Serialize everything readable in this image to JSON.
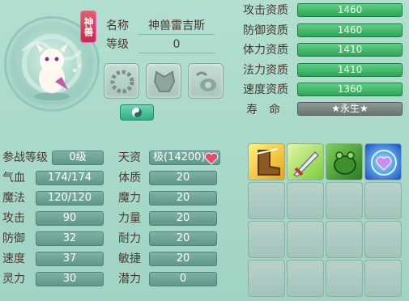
{
  "pet": {
    "badge": "神兽",
    "name_label": "名称",
    "name": "神兽雷吉斯",
    "level_label": "等级",
    "level": "0"
  },
  "aptitude": {
    "attack": {
      "label": "攻击资质",
      "value": "1460"
    },
    "defense": {
      "label": "防御资质",
      "value": "1460"
    },
    "stamina": {
      "label": "体力资质",
      "value": "1410"
    },
    "magic": {
      "label": "法力资质",
      "value": "1410"
    },
    "speed": {
      "label": "速度资质",
      "value": "1360"
    },
    "life": {
      "label": "寿　命",
      "value": "★永生★"
    }
  },
  "stats": {
    "battle_level": {
      "label": "参战等级",
      "value": "0级"
    },
    "talent": {
      "label": "天资",
      "value": "极(14200)"
    },
    "hp": {
      "label": "气血",
      "value": "174/174"
    },
    "constitution": {
      "label": "体质",
      "value": "20"
    },
    "mp": {
      "label": "魔法",
      "value": "120/120"
    },
    "magic_power": {
      "label": "魔力",
      "value": "20"
    },
    "attack": {
      "label": "攻击",
      "value": "90"
    },
    "strength": {
      "label": "力量",
      "value": "20"
    },
    "defense": {
      "label": "防御",
      "value": "32"
    },
    "endurance": {
      "label": "耐力",
      "value": "20"
    },
    "speed": {
      "label": "速度",
      "value": "37"
    },
    "agility": {
      "label": "敏捷",
      "value": "20"
    },
    "spirit": {
      "label": "灵力",
      "value": "30"
    },
    "potential": {
      "label": "潜力",
      "value": "0"
    }
  },
  "icons": {
    "heart": "heart-icon",
    "yinyang": "yinyang-icon"
  },
  "skills": [
    "boot-skill-icon",
    "sword-skill-icon",
    "frog-skill-icon",
    "heart-shield-skill-icon"
  ]
}
